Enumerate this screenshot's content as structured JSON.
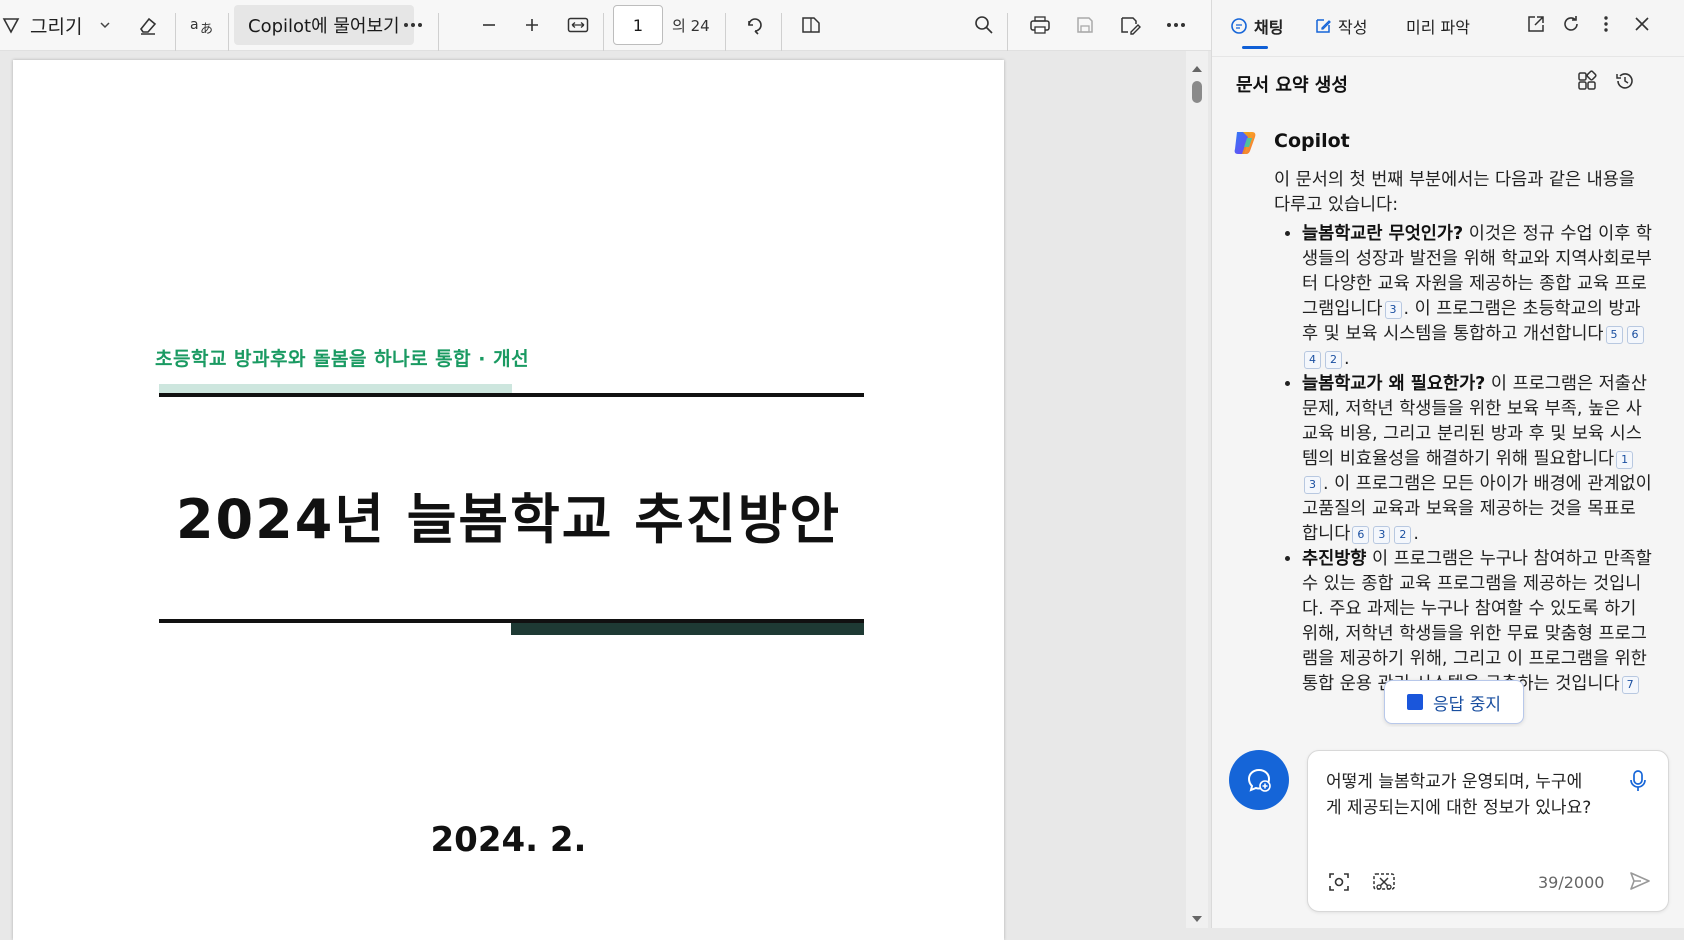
{
  "toolbar": {
    "draw_label": "그리기",
    "copilot_ask_label": "Copilot에 물어보기",
    "current_page": "1",
    "total_pages": "의 24"
  },
  "document": {
    "subtitle": "초등학교 방과후와 돌봄을 하나로 통합 · 개선",
    "title": "2024년 늘봄학교 추진방안",
    "date": "2024. 2."
  },
  "sidebar": {
    "tabs": [
      {
        "label": "채팅",
        "active": true
      },
      {
        "label": "작성",
        "active": false
      },
      {
        "label": "미리 파악",
        "active": false
      }
    ],
    "summary_title": "문서 요약 생성",
    "copilot_name": "Copilot",
    "intro": "이 문서의 첫 번째 부분에서는 다음과 같은 내용을 다루고 있습니다:",
    "bullets": [
      {
        "heading": "늘봄학교란 무엇인가?",
        "text1": " 이것은 정규 수업 이후 학생들의 성장과 발전을 위해 학교와 지역사회로부터 다양한 교육 자원을 제공하는 종합 교육 프로그램입니다",
        "cites1": [
          "3"
        ],
        "text2": ". 이 프로그램은 초등학교의 방과 후 및 보육 시스템을 통합하고 개선합니다",
        "cites2": [
          "5",
          "6",
          "4",
          "2"
        ],
        "text3": "."
      },
      {
        "heading": "늘봄학교가 왜 필요한가?",
        "text1": " 이 프로그램은 저출산 문제, 저학년 학생들을 위한 보육 부족, 높은 사교육 비용, 그리고 분리된 방과 후 및 보육 시스템의 비효율성을 해결하기 위해 필요합니다",
        "cites1": [
          "1",
          "3"
        ],
        "text2": ". 이 프로그램은 모든 아이가 배경에 관계없이 고품질의 교육과 보육을 제공하는 것을 목표로 합니다",
        "cites2": [
          "6",
          "3",
          "2"
        ],
        "text3": "."
      },
      {
        "heading": "추진방향",
        "text1": " 이 프로그램은 누구나 참여하고 만족할 수 있는 종합 교육 프로그램을 제공하는 것입니다. 주요 과제는 누구나 참여할 수 있도록 하기 위해, 저학년 학생들을 위한 무료 맞춤형 프로그램을 제공하기 위해, 그리고 이 프로그램을 위한 통합 운용 관리 시스템을 구축하는 것입니다",
        "cites1": [
          "7"
        ],
        "text2": "",
        "cites2": [],
        "text3": ""
      }
    ],
    "stop_label": "응답 중지",
    "composer_text": "어떻게 늘봄학교가 운영되며, 누구에게 제공되는지에 대한 정보가 있나요?",
    "char_count": "39/2000"
  },
  "colors": {
    "accent_blue": "#1565d8",
    "doc_green": "#1a9a62",
    "doc_dark_bar": "#1e3a34"
  }
}
